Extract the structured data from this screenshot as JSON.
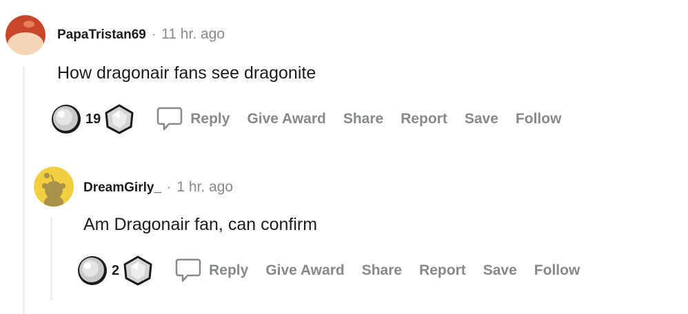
{
  "comments": [
    {
      "username": "PapaTristan69",
      "separator": "·",
      "time": "11 hr. ago",
      "body": "How dragonair fans see dragonite",
      "score": "19",
      "actions": {
        "reply": "Reply",
        "give_award": "Give Award",
        "share": "Share",
        "report": "Report",
        "save": "Save",
        "follow": "Follow"
      },
      "avatar_color": "#d9623a"
    },
    {
      "username": "DreamGirly_",
      "separator": "·",
      "time": "1 hr. ago",
      "body": "Am Dragonair fan, can confirm",
      "score": "2",
      "actions": {
        "reply": "Reply",
        "give_award": "Give Award",
        "share": "Share",
        "report": "Report",
        "save": "Save",
        "follow": "Follow"
      },
      "avatar_color": "#f2ce41"
    }
  ],
  "colors": {
    "text": "#1c1c1c",
    "muted": "#878a8c",
    "thread_line": "#eeeeee"
  }
}
